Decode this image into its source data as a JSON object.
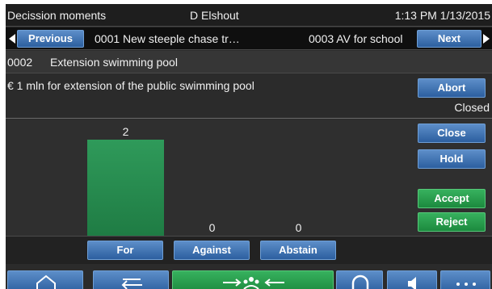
{
  "titlebar": {
    "app_title": "Decission moments",
    "user": "D Elshout",
    "datetime": "1:13 PM 1/13/2015"
  },
  "navbar": {
    "previous_label": "Previous",
    "previous_item": "0001 New steeple chase tr…",
    "next_item": "0003 AV for school",
    "next_label": "Next"
  },
  "agenda": {
    "number": "0002",
    "title": "Extension swimming pool"
  },
  "description": {
    "text": "€ 1 mln for extension of the public swimming pool",
    "abort_label": "Abort",
    "status": "Closed"
  },
  "results": {
    "for": 2,
    "against": 0,
    "abstain": 0
  },
  "actions": {
    "close_label": "Close",
    "hold_label": "Hold",
    "accept_label": "Accept",
    "reject_label": "Reject"
  },
  "votes": {
    "for_label": "For",
    "against_label": "Against",
    "abstain_label": "Abstain"
  },
  "toolbar": {
    "icons": [
      "home-icon",
      "back-icon",
      "meeting-icon",
      "headphones-icon",
      "speaker-icon",
      "more-icon"
    ]
  }
}
